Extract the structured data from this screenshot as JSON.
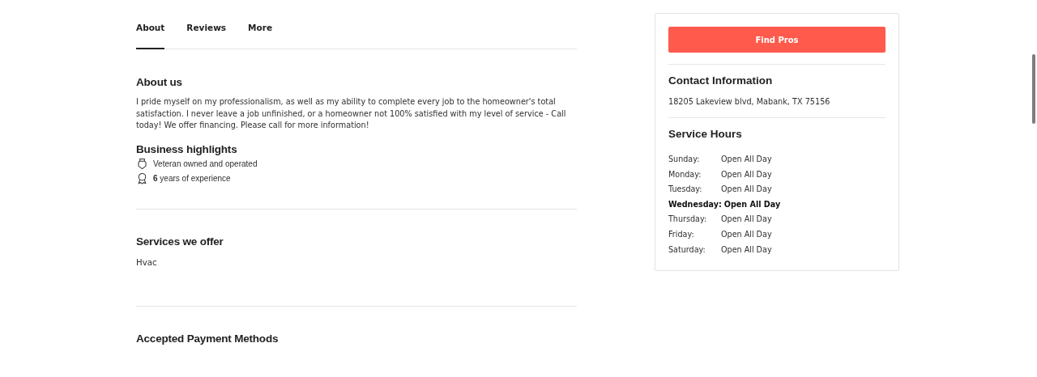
{
  "tabs": [
    {
      "label": "About",
      "selected": true
    },
    {
      "label": "Reviews",
      "selected": false
    },
    {
      "label": "More",
      "selected": false
    }
  ],
  "about": {
    "title": "About us",
    "text": "I pride myself on my professionalism, as well as my ability to complete every job to the homeowner's total satisfaction. I never leave a job unfinished, or a homeowner not 100% satisfied with my level of service - Call today! We offer financing. Please call for more information!"
  },
  "highlights": {
    "title": "Business highlights",
    "items": [
      {
        "kind": "medal",
        "text": "Veteran owned and operated"
      },
      {
        "kind": "award",
        "text": "**6** years of experience"
      }
    ]
  },
  "services": {
    "title": "Services we offer",
    "items": [
      "Hvac"
    ]
  },
  "payment": {
    "title": "Accepted Payment Methods"
  },
  "sidebar": {
    "button": "Find Pros",
    "contact_title": "Contact Information",
    "address": "18205 Lakeview blvd, Mabank, TX 75156",
    "hours_title": "Service Hours",
    "hours": [
      {
        "day": "Sunday:",
        "hours": "Open All Day",
        "current": false
      },
      {
        "day": "Monday:",
        "hours": "Open All Day",
        "current": false
      },
      {
        "day": "Tuesday:",
        "hours": "Open All Day",
        "current": false
      },
      {
        "day": "Wednesday:",
        "hours": "Open All Day",
        "current": true
      },
      {
        "day": "Thursday:",
        "hours": "Open All Day",
        "current": false
      },
      {
        "day": "Friday:",
        "hours": "Open All Day",
        "current": false
      },
      {
        "day": "Saturday:",
        "hours": "Open All Day",
        "current": false
      }
    ]
  }
}
